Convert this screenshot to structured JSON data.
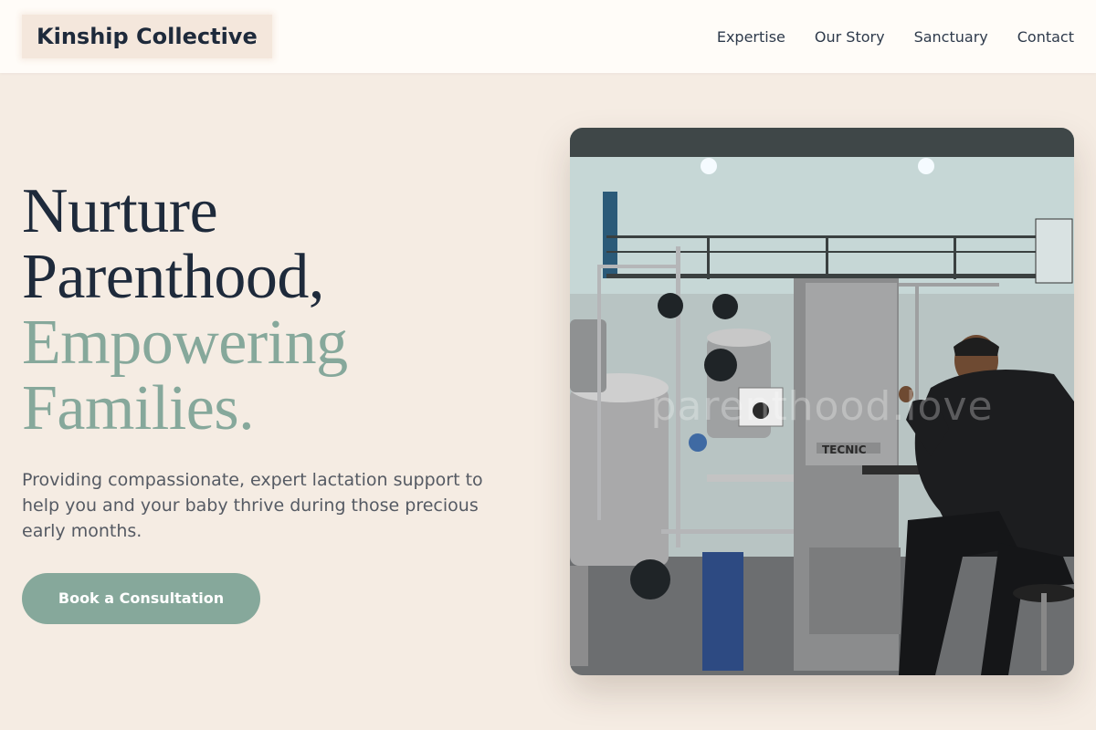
{
  "header": {
    "brand": "Kinship Collective",
    "nav": [
      {
        "label": "Expertise"
      },
      {
        "label": "Our Story"
      },
      {
        "label": "Sanctuary"
      },
      {
        "label": "Contact"
      }
    ]
  },
  "hero": {
    "headline": {
      "line1": "Nurture",
      "line2": "Parenthood,",
      "line3": "Empowering",
      "line4": "Families."
    },
    "lede": "Providing compassionate, expert lactation support to help you and your baby thrive during those precious early months.",
    "cta_label": "Book a Consultation",
    "image": {
      "watermark": "parenthood.love",
      "equipment_label": "TECNIC"
    }
  },
  "colors": {
    "background": "#f5ece3",
    "header_bg": "#fffcf8",
    "brand_bg": "#f4e7dc",
    "text_dark": "#1e2a3b",
    "accent_sage": "#86a89b",
    "body_text": "#555a63"
  }
}
